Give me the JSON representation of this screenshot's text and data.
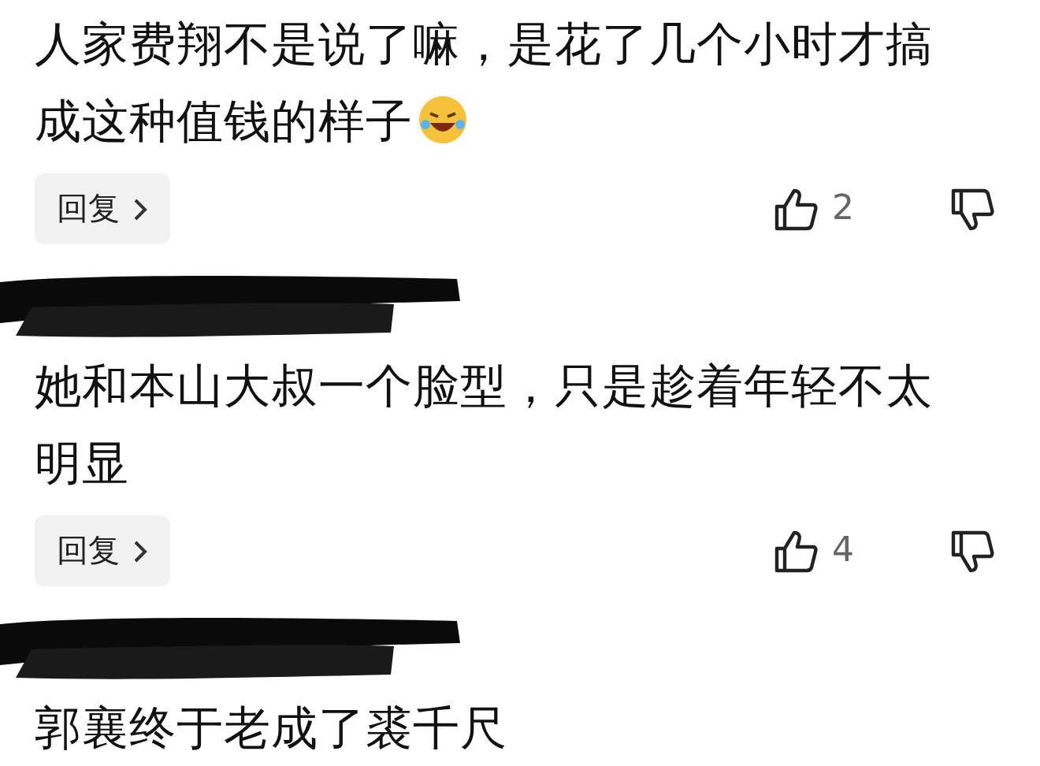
{
  "comments": [
    {
      "author_redacted": false,
      "text": "人家费翔不是说了嘛，是花了几个小时才搞成这种值钱的样子",
      "emoji": true,
      "reply": "回复",
      "likes": "2"
    },
    {
      "author_redacted": true,
      "text": "她和本山大叔一个脸型，只是趁着年轻不太明显",
      "emoji": false,
      "reply": "回复",
      "likes": "4"
    },
    {
      "author_redacted": true,
      "text": "郭襄终于老成了裘千尺",
      "emoji": false
    }
  ]
}
